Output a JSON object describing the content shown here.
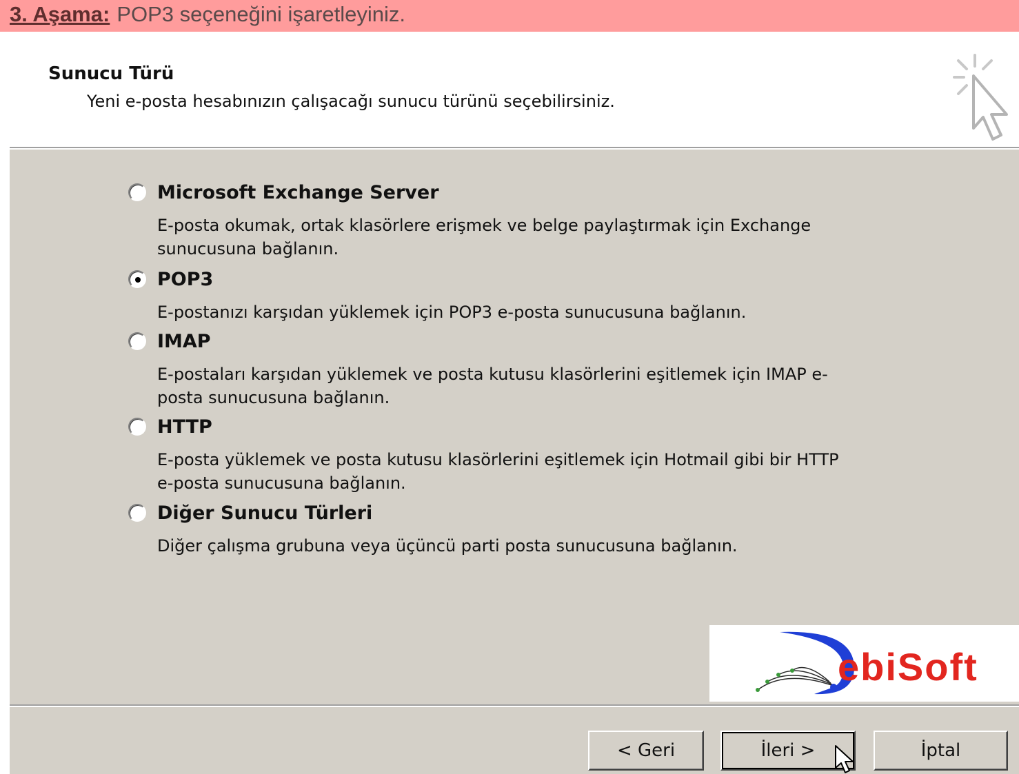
{
  "banner": {
    "step_label": "3. Aşama:",
    "instruction": "POP3 seçeneğini işaretleyiniz."
  },
  "header": {
    "title": "Sunucu Türü",
    "subtitle": "Yeni e-posta hesabınızın çalışacağı sunucu türünü seçebilirsiniz.",
    "icon": "wizard-cursor-icon"
  },
  "options": [
    {
      "label": "Microsoft Exchange Server",
      "description": "E-posta okumak, ortak klasörlere erişmek ve belge paylaştırmak için Exchange sunucusuna bağlanın.",
      "selected": false
    },
    {
      "label": "POP3",
      "description": "E-postanızı karşıdan yüklemek için POP3 e-posta sunucusuna bağlanın.",
      "selected": true
    },
    {
      "label": "IMAP",
      "description": "E-postaları karşıdan yüklemek ve posta kutusu klasörlerini eşitlemek için IMAP e-posta sunucusuna bağlanın.",
      "selected": false
    },
    {
      "label": "HTTP",
      "description": "E-posta yüklemek ve posta kutusu klasörlerini eşitlemek için Hotmail gibi bir HTTP e-posta sunucusuna bağlanın.",
      "selected": false
    },
    {
      "label": "Diğer Sunucu Türleri",
      "description": "Diğer çalışma grubuna veya üçüncü parti posta sunucusuna bağlanın.",
      "selected": false
    }
  ],
  "logo": {
    "text": "ebiSoft",
    "letter": "D",
    "colors": {
      "blue": "#1f3fd6",
      "red": "#e2261f"
    }
  },
  "footer": {
    "back_label": "< Geri",
    "next_label": "İleri >",
    "cancel_label": "İptal"
  },
  "colors": {
    "banner": "#ff9c9c",
    "dialog": "#d4d0c8"
  }
}
